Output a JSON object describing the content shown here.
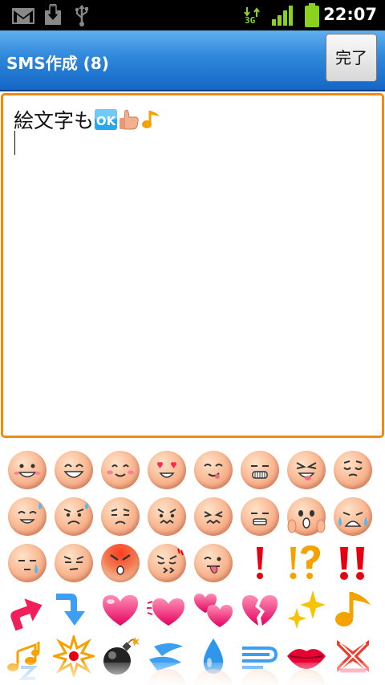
{
  "status_bar": {
    "time": "22:07",
    "network_label": "3G",
    "icons": [
      "gmail-icon",
      "download-icon",
      "usb-icon",
      "signal-3g-icon",
      "battery-icon"
    ]
  },
  "header": {
    "title": "SMS作成 (8)",
    "done_label": "完了"
  },
  "editor": {
    "text": "絵文字も",
    "inline_emoji": [
      "OK",
      "thumbs-up",
      "music-note"
    ]
  },
  "emoji_palette": {
    "rows": [
      [
        "smile",
        "laugh",
        "happy-blush",
        "heart-eyes",
        "wink-tongue",
        "grin-teeth",
        "mischief",
        "relieved"
      ],
      [
        "sweat-smile",
        "troubled",
        "sad",
        "anxious",
        "scared",
        "grimace",
        "shocked",
        "crying"
      ],
      [
        "sleepy-tear",
        "annoyed",
        "angry-red",
        "nervous",
        "tongue-out",
        "exclamation",
        "exclamation-question",
        "double-exclamation"
      ],
      [
        "arrow-up-right",
        "arrow-down-right",
        "heart",
        "heartbeat",
        "two-hearts",
        "broken-heart",
        "sparkles",
        "music-note"
      ],
      [
        "music-notes",
        "anger-burst",
        "bomb",
        "dash",
        "droplet",
        "wind",
        "lips",
        "cross-mark"
      ]
    ],
    "accent": "#e60012"
  }
}
